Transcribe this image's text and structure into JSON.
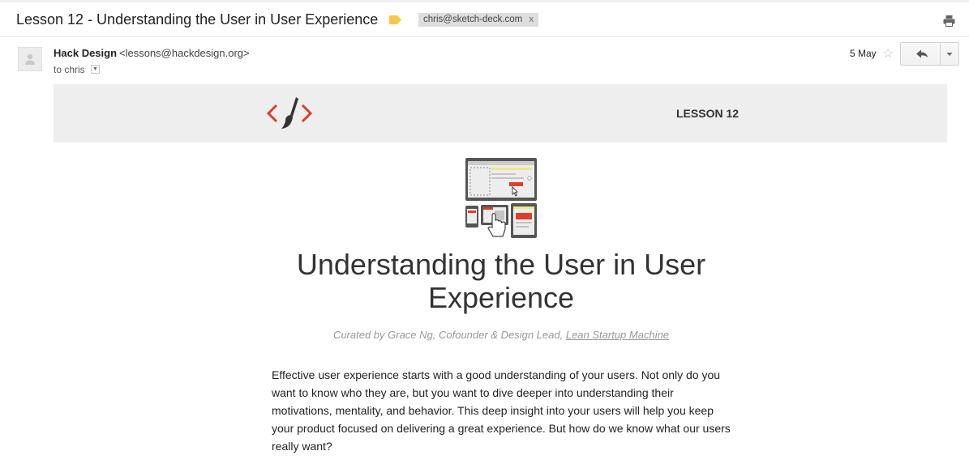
{
  "header": {
    "subject": "Lesson 12 - Understanding the User in User Experience",
    "label_chip": "chris@sketch-deck.com",
    "label_chip_close": "x"
  },
  "message": {
    "sender_name": "Hack Design",
    "sender_email": "<lessons@hackdesign.org>",
    "to_line": "to chris",
    "date": "5 May"
  },
  "email_body": {
    "banner_tag": "LESSON 12",
    "title": "Understanding the User in User Experience",
    "curator_prefix": "Curated by Grace Ng, Cofounder & Design Lead,",
    "curator_link": "Lean Startup Machine",
    "intro": "Effective user experience starts with a good understanding of your users. Not only do you want to know who they are, but you want to dive deeper into understanding their motivations, mentality, and behavior. This deep insight into your users will help you keep your product focused on delivering a great experience. But how do we know what our users really want?"
  },
  "colors": {
    "brand_red": "#d9412a",
    "label_yellow": "#f5c84c",
    "banner_bg": "#eeeeee"
  },
  "icons": [
    "label-icon",
    "print-icon",
    "avatar-icon",
    "star-icon",
    "reply-icon",
    "dropdown-icon",
    "hack-design-logo",
    "devices-illustration"
  ]
}
